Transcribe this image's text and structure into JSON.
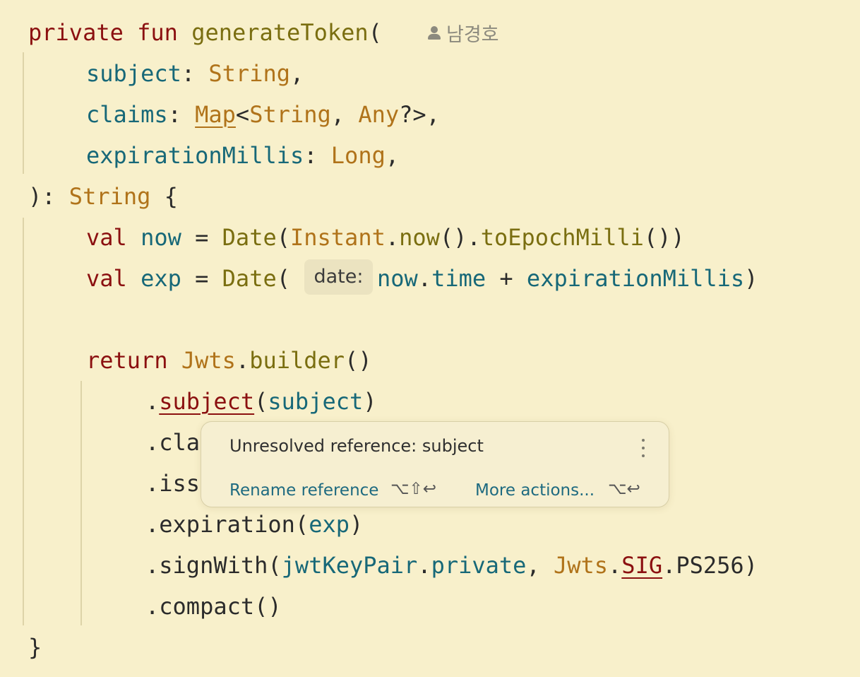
{
  "editor": {
    "author_annotation": "남경호",
    "parameter_hint": "date:",
    "lines": {
      "l1": {
        "private": "private",
        "fun": "fun",
        "name": "generateToken",
        "paren": "("
      },
      "l2": {
        "param": "subject",
        "colon": ": ",
        "type": "String",
        "comma": ","
      },
      "l3": {
        "param": "claims",
        "colon": ": ",
        "type_map": "Map",
        "lt": "<",
        "type_string": "String",
        "sep": ", ",
        "type_any": "Any",
        "tail": "?>,"
      },
      "l4": {
        "param": "expirationMillis",
        "colon": ": ",
        "type": "Long",
        "comma": ","
      },
      "l5": {
        "close": "): ",
        "type": "String",
        "brace": " {"
      },
      "l6": {
        "val": "val",
        "sp1": " ",
        "var": "now",
        "eq": " = ",
        "date": "Date",
        "p1": "(",
        "instant": "Instant",
        "dot": ".",
        "now_fn": "now",
        "p2": "().",
        "to_epoch": "toEpochMilli",
        "p3": "())"
      },
      "l7": {
        "val": "val",
        "sp1": " ",
        "var": "exp",
        "eq": " = ",
        "date": "Date",
        "p1": "(",
        "now_ref": "now",
        "dot": ".",
        "time": "time",
        "plus": " + ",
        "exp_millis": "expirationMillis",
        "p2": ")"
      },
      "l9": {
        "ret": "return",
        "sp": " ",
        "jwts": "Jwts",
        "dot": ".",
        "builder": "builder",
        "parens": "()"
      },
      "l10": {
        "dot": ".",
        "method": "subject",
        "p1": "(",
        "arg": "subject",
        "p2": ")"
      },
      "l11": {
        "text": ".cla"
      },
      "l12": {
        "text": ".iss"
      },
      "l13": {
        "pre": ".expiration(",
        "arg": "exp",
        "post": ")"
      },
      "l14": {
        "pre": ".signWith(",
        "kp": "jwtKeyPair",
        "dot": ".",
        "priv": "private",
        "sep": ", ",
        "jwts": "Jwts",
        "dot2": ".",
        "sig": "SIG",
        "tail": ".PS256)"
      },
      "l15": {
        "text": ".compact()"
      },
      "l16": {
        "text": "}"
      }
    }
  },
  "popup": {
    "message": "Unresolved reference: subject",
    "rename_label": "Rename reference",
    "rename_shortcut": "⌥⇧↩",
    "more_label": "More actions...",
    "more_shortcut": "⌥↩",
    "menu_icon": "kebab-menu-icon"
  }
}
